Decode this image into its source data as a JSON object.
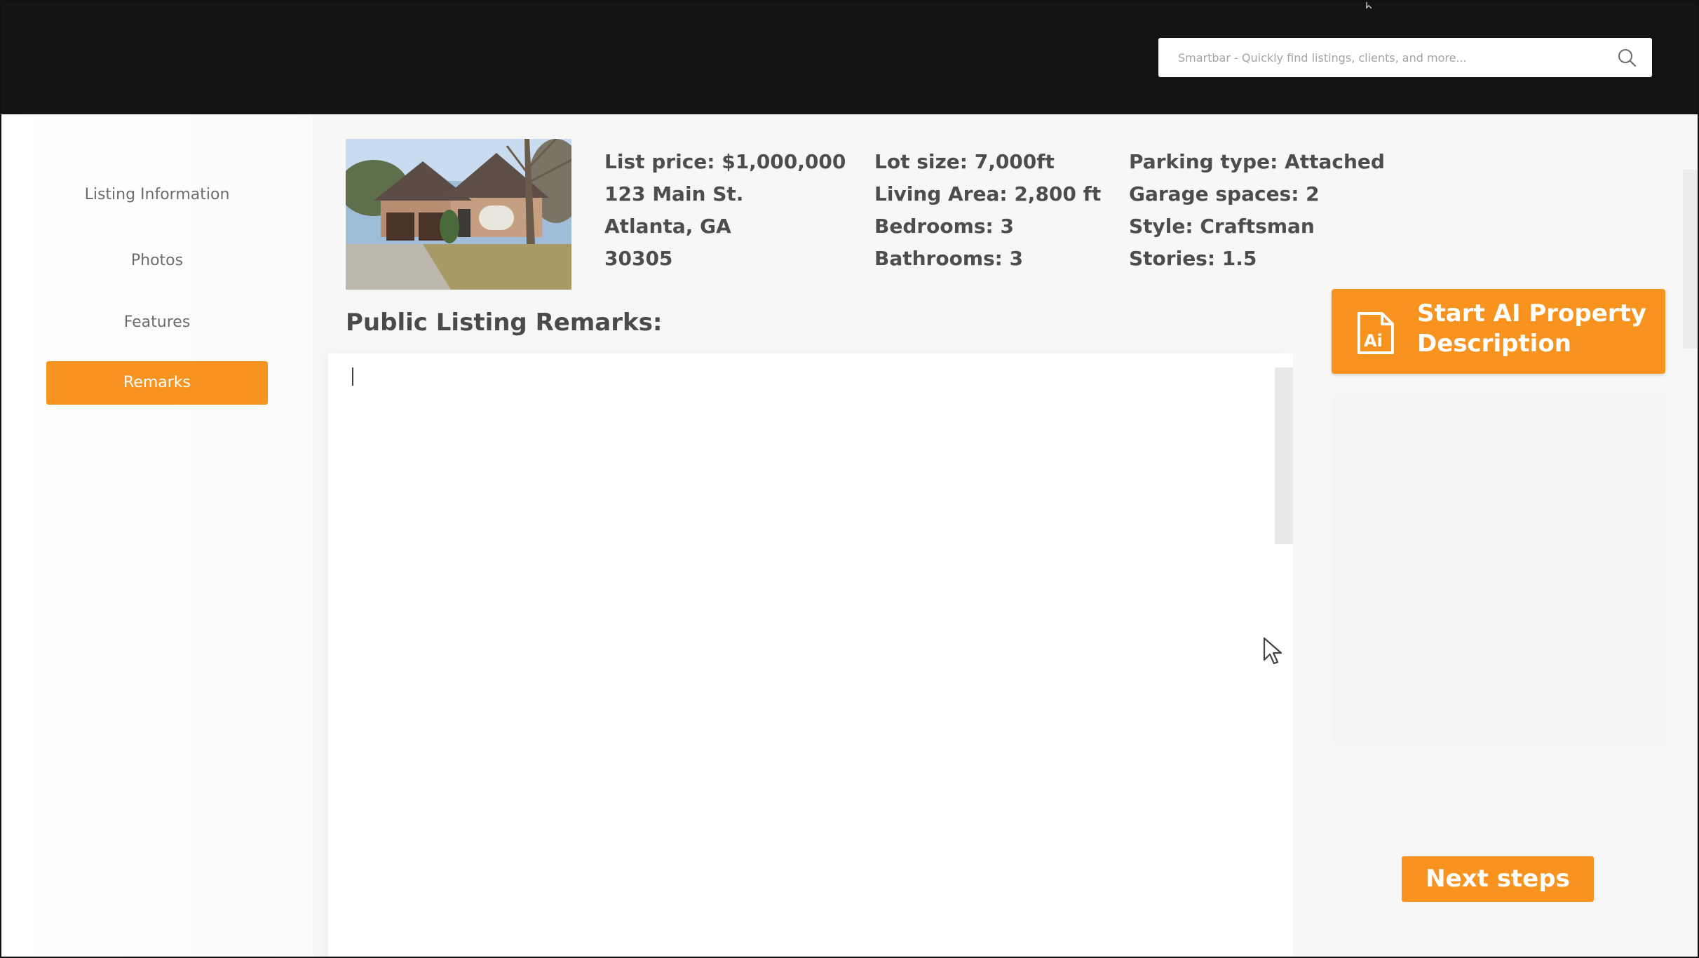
{
  "header": {
    "search_placeholder": "Smartbar - Quickly find listings, clients, and more...",
    "search_icon": "search-icon"
  },
  "sidebar": {
    "items": [
      {
        "label": "Listing Information",
        "active": false
      },
      {
        "label": "Photos",
        "active": false
      },
      {
        "label": "Features",
        "active": false
      },
      {
        "label": "Remarks",
        "active": true
      }
    ]
  },
  "listing": {
    "photo_icon": "house-photo",
    "col1": [
      "List price: $1,000,000",
      "123 Main St.",
      "Atlanta, GA",
      "30305"
    ],
    "col2": [
      "Lot size: 7,000ft",
      "Living Area: 2,800 ft",
      "Bedrooms: 3",
      "Bathrooms: 3"
    ],
    "col3": [
      "Parking type: Attached",
      "Garage spaces: 2",
      "Style: Craftsman",
      "Stories: 1.5"
    ]
  },
  "remarks": {
    "heading": "Public Listing Remarks:",
    "value": ""
  },
  "ai_button": {
    "icon": "ai-document-icon",
    "label": "Start AI Property Description"
  },
  "next_button": {
    "label": "Next steps"
  },
  "colors": {
    "accent": "#f7931e",
    "topbar": "#141414",
    "text": "#4d4d4d"
  }
}
